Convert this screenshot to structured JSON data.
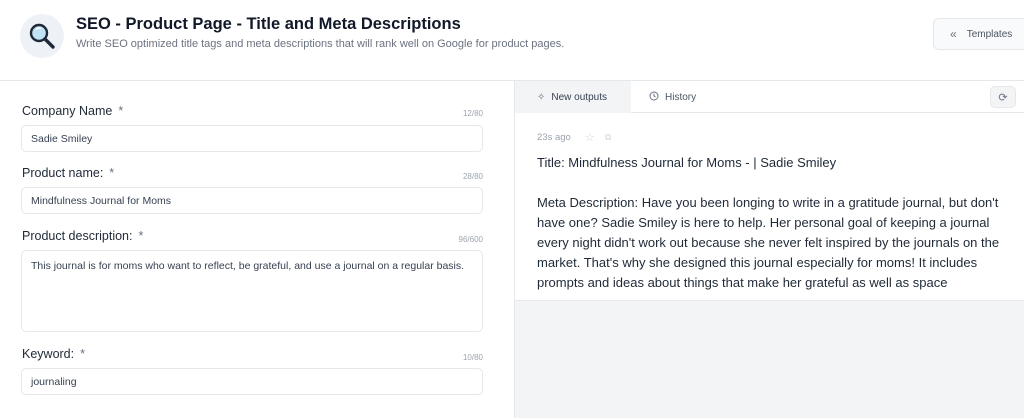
{
  "header": {
    "title": "SEO - Product Page - Title and Meta Descriptions",
    "subtitle": "Write SEO optimized title tags and meta descriptions that will rank well on Google for product pages.",
    "icon": "magnifier-icon",
    "templates_label": "Templates"
  },
  "form": {
    "company": {
      "label": "Company Name",
      "required": "*",
      "counter": "12/80",
      "value": "Sadie Smiley"
    },
    "product_name": {
      "label": "Product name:",
      "required": "*",
      "counter": "28/80",
      "value": "Mindfulness Journal for Moms"
    },
    "product_description": {
      "label": "Product description:",
      "required": "*",
      "counter": "96/600",
      "value": "This journal is for moms who want to reflect, be grateful, and use a journal on a regular basis."
    },
    "keyword": {
      "label": "Keyword:",
      "required": "*",
      "counter": "10/80",
      "value": "journaling"
    }
  },
  "right": {
    "tabs": [
      {
        "label": "New outputs",
        "icon": "sparkle-icon"
      },
      {
        "label": "History",
        "icon": "clock-icon"
      }
    ],
    "output": {
      "time": "23s ago",
      "title": "Title: Mindfulness Journal for Moms - | Sadie Smiley",
      "description": "Meta Description: Have you been longing to write in a gratitude journal, but don't have one? Sadie Smiley is here to help. Her personal goal of keeping a journal every night didn't work out because she never felt inspired by the journals on the market. That's why she designed this journal especially for moms! It includes prompts and ideas about things that make her grateful as well as space"
    }
  },
  "colors": {
    "panel_bg": "#f3f4f6",
    "border": "#e5e7eb",
    "text": "#1f2937"
  }
}
